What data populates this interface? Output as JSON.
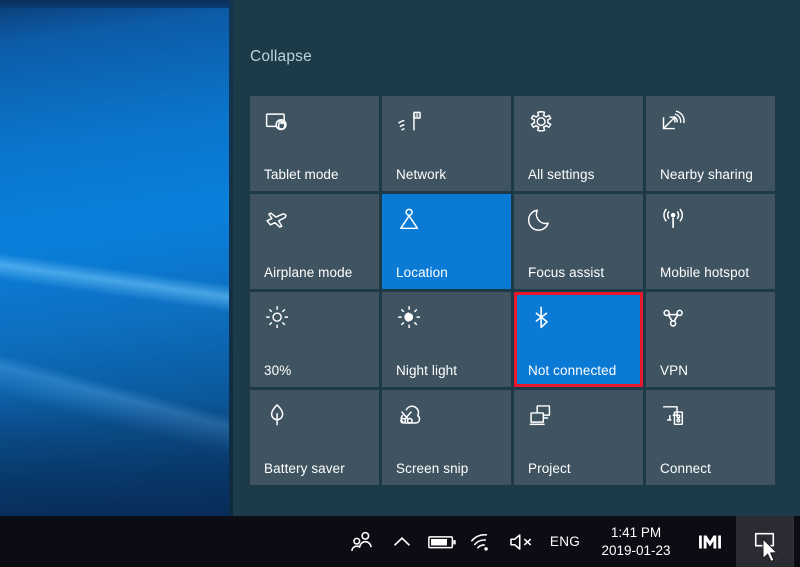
{
  "desktop": {
    "wallpaper_name": "windows-10-hero-blue",
    "accent_color": "#0a7ad4"
  },
  "action_center": {
    "collapse_label": "Collapse",
    "panel_color": "#1c3a48",
    "tile_color": "#3f5361",
    "tile_active_color": "#0a7ad4",
    "highlight_color": "#e8192c",
    "tiles": [
      {
        "label": "Tablet mode",
        "icon": "tablet-mode-icon",
        "state": "off"
      },
      {
        "label": "Network",
        "icon": "network-icon",
        "state": "off"
      },
      {
        "label": "All settings",
        "icon": "settings-gear-icon",
        "state": "off"
      },
      {
        "label": "Nearby sharing",
        "icon": "nearby-sharing-icon",
        "state": "off"
      },
      {
        "label": "Airplane mode",
        "icon": "airplane-icon",
        "state": "off"
      },
      {
        "label": "Location",
        "icon": "location-icon",
        "state": "on"
      },
      {
        "label": "Focus assist",
        "icon": "moon-icon",
        "state": "off"
      },
      {
        "label": "Mobile hotspot",
        "icon": "hotspot-icon",
        "state": "off"
      },
      {
        "label": "30%",
        "icon": "brightness-icon",
        "state": "off"
      },
      {
        "label": "Night light",
        "icon": "night-light-icon",
        "state": "off"
      },
      {
        "label": "Not connected",
        "icon": "bluetooth-icon",
        "state": "on",
        "highlighted": true
      },
      {
        "label": "VPN",
        "icon": "vpn-icon",
        "state": "off"
      },
      {
        "label": "Battery saver",
        "icon": "leaf-icon",
        "state": "off"
      },
      {
        "label": "Screen snip",
        "icon": "screen-snip-icon",
        "state": "off"
      },
      {
        "label": "Project",
        "icon": "project-icon",
        "state": "off"
      },
      {
        "label": "Connect",
        "icon": "connect-icon",
        "state": "off"
      }
    ]
  },
  "taskbar": {
    "background_color": "#0c0d14",
    "tray": {
      "people_icon": "people-icon",
      "show_hidden_icons": "chevron-up-icon",
      "battery_icon": "battery-icon",
      "network_icon": "wifi-icon",
      "volume_icon": "speaker-muted-icon",
      "language": "ENG",
      "time": "1:41 PM",
      "date": "2019-01-23",
      "app_icon": "m-logo-icon",
      "action_center_icon": "speech-bubble-icon"
    }
  }
}
